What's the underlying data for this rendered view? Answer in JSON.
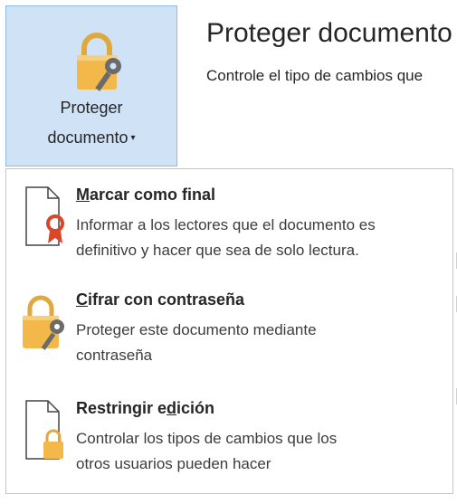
{
  "protect_button": {
    "line1": "Proteger",
    "line2": "documento",
    "caret": "▾",
    "icon": "lock-key-icon"
  },
  "header": {
    "title": "Proteger documento",
    "description": "Controle el tipo de cambios que"
  },
  "menu": {
    "items": [
      {
        "title_pre": "",
        "title_ul": "M",
        "title_post": "arcar como final",
        "desc1": "Informar a los lectores que el documento es",
        "desc2": "definitivo y hacer que sea de solo lectura.",
        "icon": "document-ribbon-icon"
      },
      {
        "title_pre": "",
        "title_ul": "C",
        "title_post": "ifrar con contraseña",
        "desc1": "Proteger este documento mediante",
        "desc2": "contraseña",
        "icon": "lock-key-icon"
      },
      {
        "title_pre": "Restringir e",
        "title_ul": "d",
        "title_post": "ición",
        "desc1": "Controlar los tipos de cambios que los",
        "desc2": "otros usuarios pueden hacer",
        "icon": "document-lock-icon"
      }
    ]
  },
  "colors": {
    "button_bg": "#cfe2f6",
    "button_border": "#8fb9e6",
    "lock_gold": "#f2b84a",
    "ribbon_red": "#d9472b"
  }
}
